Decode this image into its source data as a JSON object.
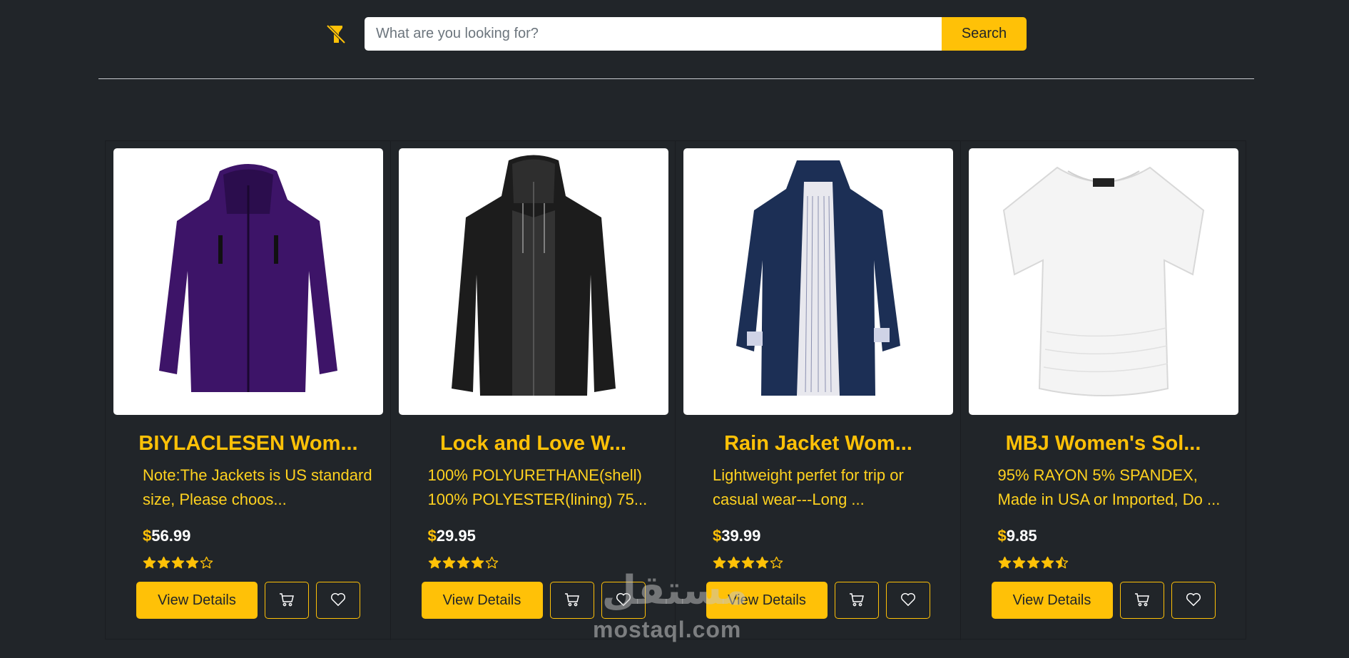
{
  "header": {
    "logo_icon": "flashlight-off-icon",
    "search": {
      "placeholder": "What are you looking for?",
      "value": "",
      "button_label": "Search"
    }
  },
  "colors": {
    "background": "#212529",
    "accent": "#ffc107",
    "description": "#ffd21f"
  },
  "products": [
    {
      "title": "BIYLACLESEN Wom...",
      "description_lines": [
        "Note:The Jackets is US standard",
        "size, Please choos..."
      ],
      "currency": "$",
      "price": "56.99",
      "rating": 4,
      "image": "purple-jacket",
      "view_label": "View Details",
      "cart_icon": "cart-icon",
      "wishlist_icon": "heart-icon"
    },
    {
      "title": "Lock and Love W...",
      "description_lines": [
        "100% POLYURETHANE(shell)",
        "100% POLYESTER(lining) 75..."
      ],
      "currency": "$",
      "price": "29.95",
      "rating": 4,
      "image": "black-leather-jacket",
      "view_label": "View Details",
      "cart_icon": "cart-icon",
      "wishlist_icon": "heart-icon"
    },
    {
      "title": "Rain Jacket Wom...",
      "description_lines": [
        "Lightweight perfet for trip or",
        "casual wear---Long ..."
      ],
      "currency": "$",
      "price": "39.99",
      "rating": 4,
      "image": "navy-rain-jacket",
      "view_label": "View Details",
      "cart_icon": "cart-icon",
      "wishlist_icon": "heart-icon"
    },
    {
      "title": "MBJ Women's Sol...",
      "description_lines": [
        "95% RAYON 5% SPANDEX,",
        "Made in USA or Imported, Do ..."
      ],
      "currency": "$",
      "price": "9.85",
      "rating": 4.5,
      "image": "white-top",
      "view_label": "View Details",
      "cart_icon": "cart-icon",
      "wishlist_icon": "heart-icon"
    }
  ],
  "watermark": {
    "arabic": "مستقل",
    "latin": "mostaql.com"
  }
}
